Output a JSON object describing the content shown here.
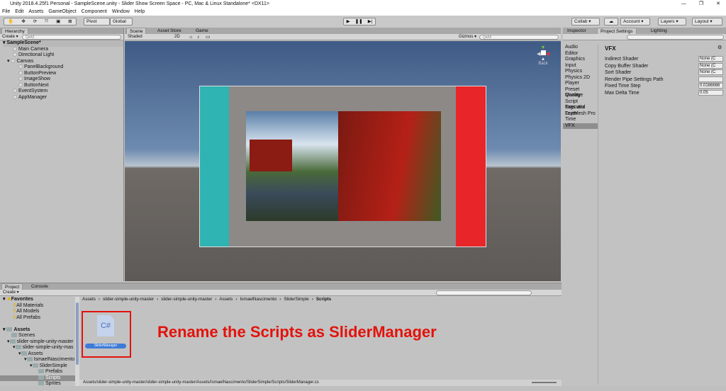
{
  "window": {
    "title": "Unity 2018.4.25f1 Personal - SampleScene.unity - Slider Show Screen Space - PC, Mac & Linux Standalone* <DX11>",
    "controls": [
      "—",
      "❐",
      "✕"
    ]
  },
  "menu": [
    "File",
    "Edit",
    "Assets",
    "GameObject",
    "Component",
    "Window",
    "Help"
  ],
  "toolbar": {
    "pivot": "Pivot",
    "global": "Global",
    "collab": "Collab ▾",
    "account": "Account ▾",
    "layers": "Layers ▾",
    "layout": "Layout ▾"
  },
  "hierarchy": {
    "tab": "Hierarchy",
    "create": "Create ▾",
    "search_placeholder": "Q▾All",
    "scene": "SampleScene*",
    "items": [
      "Main Camera",
      "Directional Light",
      "Canvas",
      "PanelBackground",
      "ButtonPreview",
      "ImageShow",
      "ButtonNext",
      "EventSystem",
      "AppManager"
    ]
  },
  "scene": {
    "tabs": [
      "Scene",
      "Asset Store",
      "Game"
    ],
    "shading": "Shaded",
    "mode2d": "2D",
    "gizmos": "Gizmos ▾",
    "search_placeholder": "Q▾All",
    "back": "Back",
    "axis_y": "y",
    "axis_x": "x"
  },
  "inspector": {
    "tabs": [
      "Inspector",
      "Project Settings",
      "Lighting"
    ],
    "categories": [
      "Audio",
      "Editor",
      "Graphics",
      "Input",
      "Physics",
      "Physics 2D",
      "Player",
      "Preset Manage",
      "Quality",
      "Script Executio",
      "Tags and Layer",
      "TextMesh Pro",
      "Time",
      "VFX"
    ],
    "selected": "VFX",
    "heading": "VFX",
    "fields": [
      {
        "label": "Indirect Shader",
        "value": "None (C"
      },
      {
        "label": "Copy Buffer Shader",
        "value": "None (C"
      },
      {
        "label": "Sort Shader",
        "value": "None (C"
      },
      {
        "label": "Render Pipe Settings Path",
        "value": ""
      },
      {
        "label": "Fixed Time Step",
        "value": "0.0166666"
      },
      {
        "label": "Max Delta Time",
        "value": "0.05"
      }
    ]
  },
  "project": {
    "tabs": [
      "Project",
      "Console"
    ],
    "create": "Create ▾",
    "favorites": "Favorites",
    "fav_items": [
      "All Materials",
      "All Models",
      "All Prefabs"
    ],
    "assets": "Assets",
    "tree": [
      "Scenes",
      "slider-simple-unity-master",
      "slider-simple-unity-mas",
      "Assets",
      "IsmaelNascimento",
      "SliderSimple",
      "Prefabs",
      "Scripts",
      "Sprites"
    ],
    "breadcrumb": [
      "Assets",
      "slider-simple-unity-master",
      "slider-simple-unity-master",
      "Assets",
      "IsmaelNascimento",
      "SliderSimple",
      "Scripts"
    ],
    "file_glyph": "C#",
    "file_name": "SliderManager",
    "annotation": "Rename the Scripts as SliderManager",
    "status_path": "Assets/slider-simple-unity-master/slider-simple-unity-master/Assets/IsmaelNascimento/SliderSimple/Scripts/SliderManager.cs"
  },
  "colors": {
    "teal": "#2fb3b3",
    "red": "#e8262a",
    "annotation": "#e3120b",
    "selection": "#3e7bd8"
  }
}
